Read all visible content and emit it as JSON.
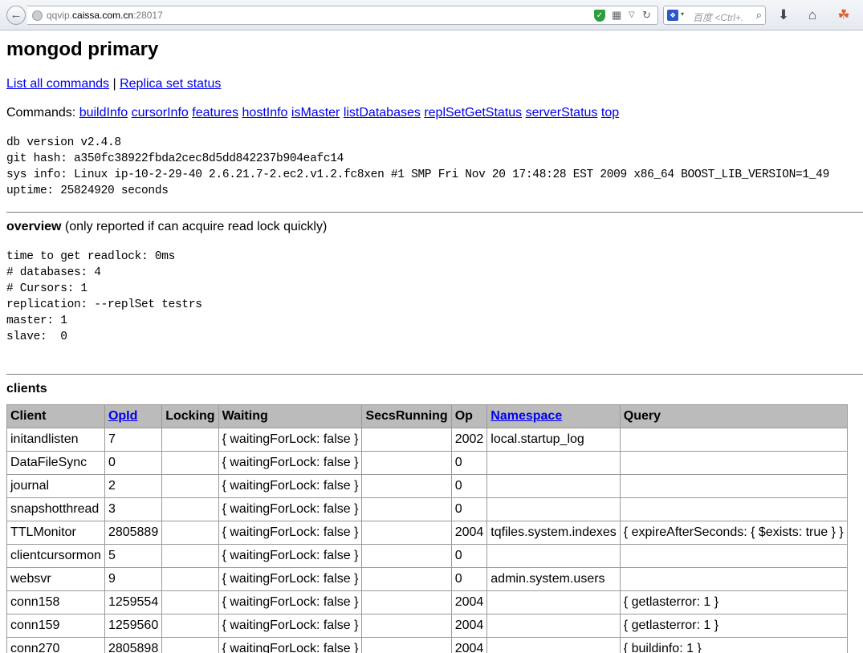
{
  "browser": {
    "url_prefix": "qqvip.",
    "url_domain": "caissa.com.cn",
    "url_port": ":28017",
    "search_placeholder": "百度 <Ctrl+."
  },
  "page": {
    "title": "mongod primary",
    "links": [
      "List all commands",
      "Replica set status"
    ],
    "link_separator": " | ",
    "commands_label": "Commands:",
    "commands": [
      "buildInfo",
      "cursorInfo",
      "features",
      "hostInfo",
      "isMaster",
      "listDatabases",
      "replSetGetStatus",
      "serverStatus",
      "top"
    ],
    "info_lines": [
      "db version v2.4.8",
      "git hash: a350fc38922fbda2cec8d5dd842237b904eafc14",
      "sys info: Linux ip-10-2-29-40 2.6.21.7-2.ec2.v1.2.fc8xen #1 SMP Fri Nov 20 17:48:28 EST 2009 x86_64 BOOST_LIB_VERSION=1_49",
      "uptime: 25824920 seconds"
    ],
    "overview_title": "overview",
    "overview_note": " (only reported if can acquire read lock quickly)",
    "overview_lines": [
      "time to get readlock: 0ms",
      "# databases: 4",
      "# Cursors: 1",
      "replication: --replSet testrs",
      "master: 1",
      "slave:  0"
    ],
    "clients_title": "clients"
  },
  "clients_table": {
    "headers": [
      {
        "label": "Client",
        "link": false
      },
      {
        "label": "OpId",
        "link": true
      },
      {
        "label": "Locking",
        "link": false
      },
      {
        "label": "Waiting",
        "link": false
      },
      {
        "label": "SecsRunning",
        "link": false
      },
      {
        "label": "Op",
        "link": false
      },
      {
        "label": "Namespace",
        "link": true
      },
      {
        "label": "Query",
        "link": false
      }
    ],
    "rows": [
      [
        "initandlisten",
        "7",
        "",
        "{ waitingForLock: false }",
        "",
        "2002",
        "local.startup_log",
        ""
      ],
      [
        "DataFileSync",
        "0",
        "",
        "{ waitingForLock: false }",
        "",
        "0",
        "",
        ""
      ],
      [
        "journal",
        "2",
        "",
        "{ waitingForLock: false }",
        "",
        "0",
        "",
        ""
      ],
      [
        "snapshotthread",
        "3",
        "",
        "{ waitingForLock: false }",
        "",
        "0",
        "",
        ""
      ],
      [
        "TTLMonitor",
        "2805889",
        "",
        "{ waitingForLock: false }",
        "",
        "2004",
        "tqfiles.system.indexes",
        "{ expireAfterSeconds: { $exists: true } }"
      ],
      [
        "clientcursormon",
        "5",
        "",
        "{ waitingForLock: false }",
        "",
        "0",
        "",
        ""
      ],
      [
        "websvr",
        "9",
        "",
        "{ waitingForLock: false }",
        "",
        "0",
        "admin.system.users",
        ""
      ],
      [
        "conn158",
        "1259554",
        "",
        "{ waitingForLock: false }",
        "",
        "2004",
        "",
        "{ getlasterror: 1 }"
      ],
      [
        "conn159",
        "1259560",
        "",
        "{ waitingForLock: false }",
        "",
        "2004",
        "",
        "{ getlasterror: 1 }"
      ],
      [
        "conn270",
        "2805898",
        "",
        "{ waitingForLock: false }",
        "",
        "2004",
        "",
        "{ buildinfo: 1 }"
      ]
    ]
  }
}
